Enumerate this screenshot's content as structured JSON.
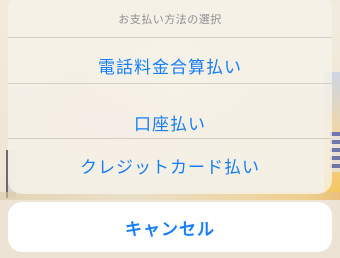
{
  "action_sheet": {
    "title": "お支払い方法の選択",
    "options": [
      "電話料金合算払い",
      "口座払い",
      "クレジットカード払い"
    ],
    "cancel_label": "キャンセル"
  },
  "colors": {
    "accent": "#147efb",
    "title_gray": "#8e8e93",
    "sheet_background": "#f6f2ea",
    "cancel_background": "#ffffff"
  }
}
